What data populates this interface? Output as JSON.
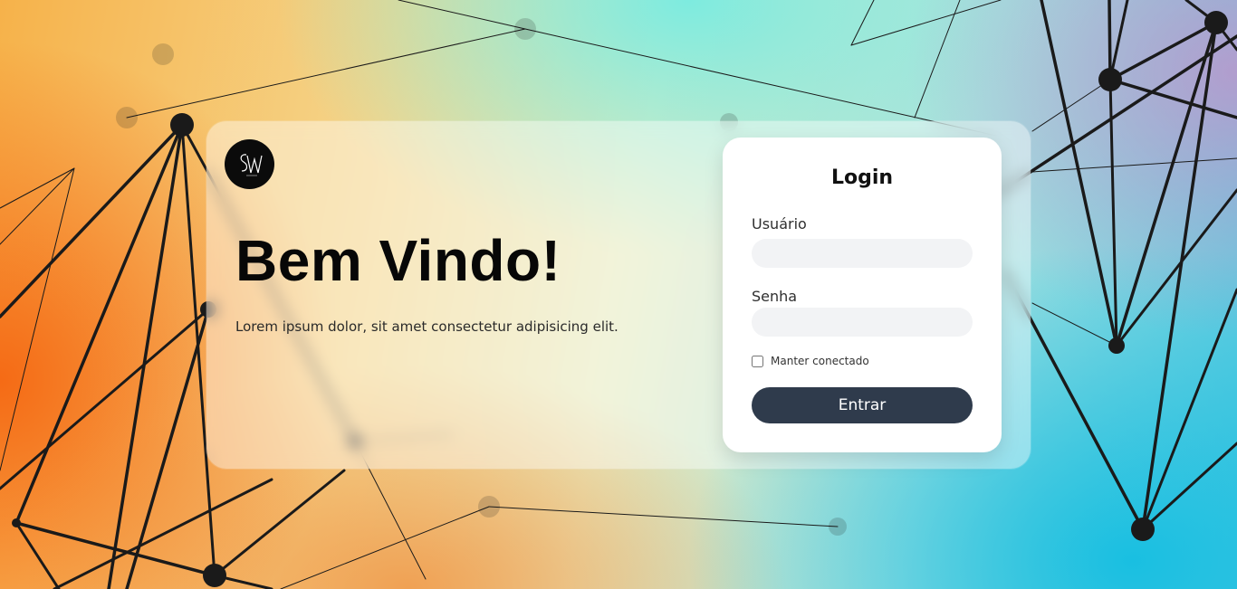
{
  "hero": {
    "title": "Bem Vindo!",
    "subtitle": "Lorem ipsum dolor, sit amet consectetur adipisicing elit."
  },
  "login": {
    "title": "Login",
    "username_label": "Usuário",
    "password_label": "Senha",
    "remember_label": "Manter conectado",
    "submit_label": "Entrar"
  }
}
